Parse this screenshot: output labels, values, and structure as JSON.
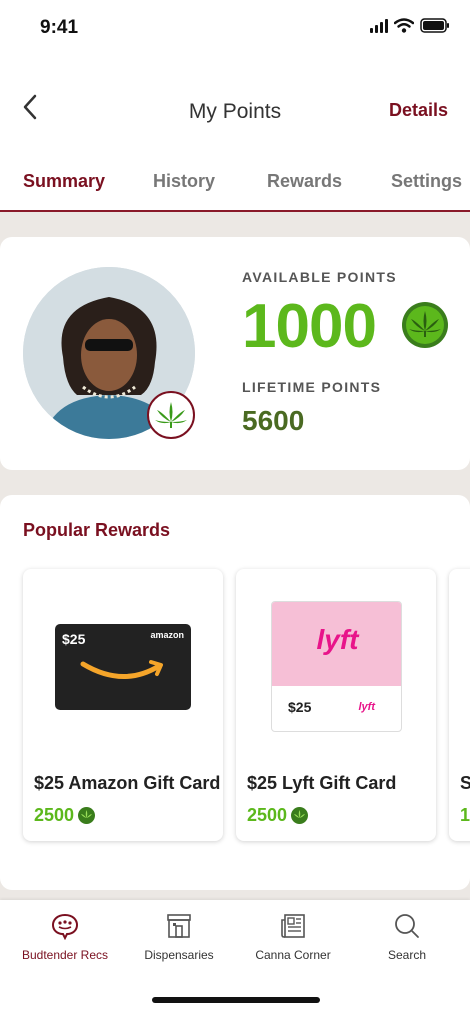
{
  "status": {
    "time": "9:41"
  },
  "nav": {
    "title": "My Points",
    "details": "Details"
  },
  "tabs": [
    "Summary",
    "History",
    "Rewards",
    "Settings"
  ],
  "points": {
    "available_label": "AVAILABLE POINTS",
    "available_value": "1000",
    "lifetime_label": "LIFETIME POINTS",
    "lifetime_value": "5600"
  },
  "rewards": {
    "title": "Popular Rewards",
    "items": [
      {
        "name": "$25 Amazon Gift Card",
        "cost": "2500",
        "card_amount": "$25",
        "brand": "amazon"
      },
      {
        "name": "$25 Lyft Gift Card",
        "cost": "2500",
        "card_amount": "$25",
        "brand": "lyft"
      },
      {
        "name": "S",
        "cost": "1"
      }
    ]
  },
  "tabbar": [
    "Budtender Recs",
    "Dispensaries",
    "Canna Corner",
    "Search"
  ],
  "colors": {
    "accent": "#7a1020",
    "green": "#5cb81c",
    "leaf_bg": "#3a7d1c"
  },
  "icons": [
    "back-chevron-icon",
    "leaf-icon",
    "budtender-chat-icon",
    "store-icon",
    "newspaper-icon",
    "search-icon"
  ]
}
